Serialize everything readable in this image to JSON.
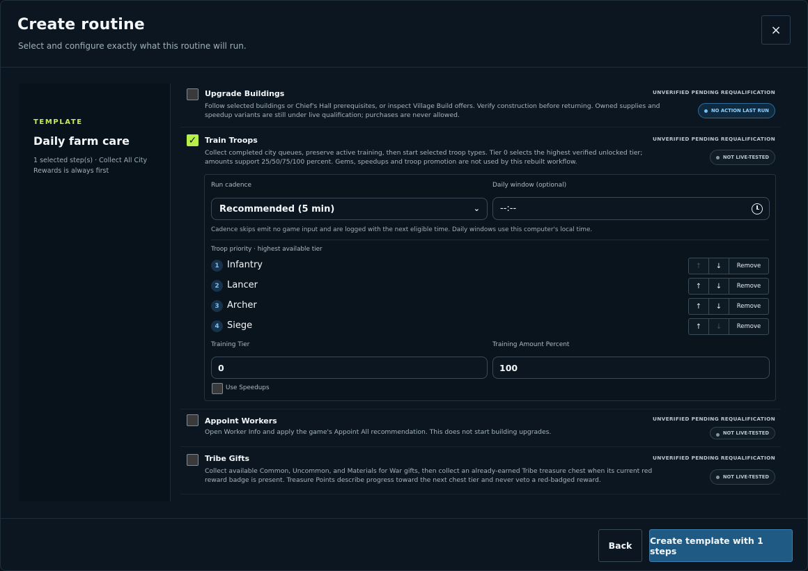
{
  "header": {
    "title": "Create routine",
    "subtitle": "Select and configure exactly what this routine will run.",
    "close_label": "×"
  },
  "sidebar": {
    "label": "TEMPLATE",
    "name": "Daily farm care",
    "description": "1 selected step(s) · Collect All City Rewards is always first"
  },
  "steps": [
    {
      "name": "Upgrade Buildings",
      "checked": false,
      "description": "Follow selected buildings or Chief's Hall prerequisites, or inspect Village Build offers. Verify construction before returning. Owned supplies and speedup variants are still under live qualification; purchases are never allowed.",
      "status": "UNVERIFIED PENDING REQUALIFICATION",
      "badge": "NO ACTION LAST RUN"
    },
    {
      "name": "Train Troops",
      "checked": true,
      "check_mark": "✓",
      "description": "Collect completed city queues, preserve active training, then start selected troop types. Tier 0 selects the highest verified unlocked tier; amounts support 25/50/75/100 percent. Gems, speedups and troop promotion are not used by this rebuilt workflow.",
      "status": "UNVERIFIED PENDING REQUALIFICATION",
      "badge": "NOT LIVE-TESTED"
    },
    {
      "name": "Appoint Workers",
      "checked": false,
      "description": "Open Worker Info and apply the game's Appoint All recommendation. This does not start building upgrades.",
      "status": "UNVERIFIED PENDING REQUALIFICATION",
      "badge": "NOT LIVE-TESTED"
    },
    {
      "name": "Tribe Gifts",
      "checked": false,
      "description": "Collect available Common, Uncommon, and Materials for War gifts, then collect an already-earned Tribe treasure chest when its current red reward badge is present. Treasure Points describe progress toward the next chest tier and never veto a red-badged reward.",
      "status": "UNVERIFIED PENDING REQUALIFICATION",
      "badge": "NOT LIVE-TESTED"
    }
  ],
  "config": {
    "cadence_label": "Run cadence",
    "cadence_value": "Recommended (5 min)",
    "window_label": "Daily window (optional)",
    "window_value": "--:--",
    "hint": "Cadence skips emit no game input and are logged with the next eligible time. Daily windows use this computer's local time.",
    "priority_label": "Troop priority · highest available tier",
    "troops": [
      {
        "num": "1",
        "name": "Infantry"
      },
      {
        "num": "2",
        "name": "Lancer"
      },
      {
        "num": "3",
        "name": "Archer"
      },
      {
        "num": "4",
        "name": "Siege"
      }
    ],
    "up_glyph": "↑",
    "down_glyph": "↓",
    "remove_label": "Remove",
    "tier_label": "Training Tier",
    "tier_value": "0",
    "amount_label": "Training Amount Percent",
    "amount_value": "100",
    "speedups_label": "Use Speedups"
  },
  "footer": {
    "back_label": "Back",
    "create_label": "Create template with 1 steps"
  },
  "colors": {
    "accent": "#b8f04a",
    "primary": "#1e5a84",
    "background": "#0b1620"
  }
}
